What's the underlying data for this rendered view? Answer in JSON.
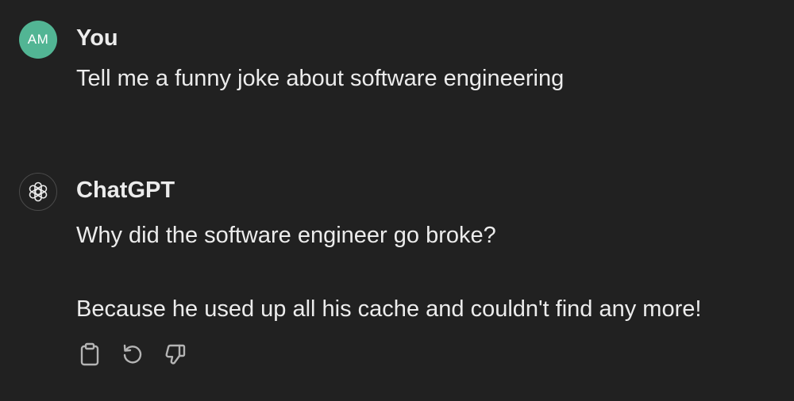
{
  "conversation": {
    "user_message": {
      "avatar_initials": "AM",
      "avatar_color": "#52b594",
      "author": "You",
      "text": "Tell me a funny joke about software engineering"
    },
    "assistant_message": {
      "avatar_icon": "openai-logo-icon",
      "author": "ChatGPT",
      "paragraphs": [
        "Why did the software engineer go broke?",
        "Because he used up all his cache and couldn't find any more!"
      ],
      "actions": [
        {
          "icon": "clipboard-icon"
        },
        {
          "icon": "regenerate-icon"
        },
        {
          "icon": "thumbs-down-icon"
        }
      ]
    }
  },
  "colors": {
    "background": "#212121",
    "text": "#ececec",
    "icon": "#b4b4b4"
  }
}
